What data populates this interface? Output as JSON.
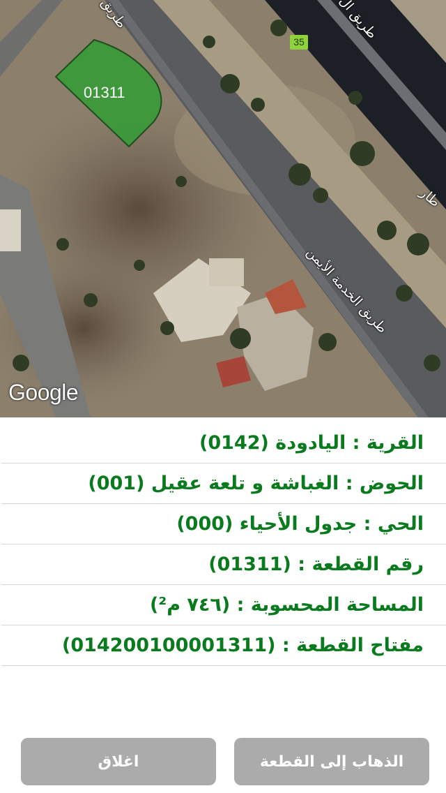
{
  "map": {
    "attribution": "Google",
    "route_badge": "35",
    "parcel_label": "01311",
    "road_labels": [
      "طريق",
      "طريق ال",
      "طار",
      "طريق الخدمة الأيمن"
    ]
  },
  "parcel_info": {
    "rows": [
      "القرية : اليادودة (0142)",
      "الحوض : الغباشة و تلعة عقيل (001)",
      "الحي : جدول الأحياء (000)",
      "رقم القطعة : (01311)",
      "المساحة المحسوبة : (٧٤٦ م²)",
      "مفتاح القطعة : (014200100001311)"
    ]
  },
  "buttons": {
    "close_label": "اغلاق",
    "goto_label": "الذهاب إلى القطعة"
  },
  "colors": {
    "info_text": "#0a7a1e",
    "parcel_fill": "#3a9a3a",
    "button_bg": "#ababab"
  }
}
